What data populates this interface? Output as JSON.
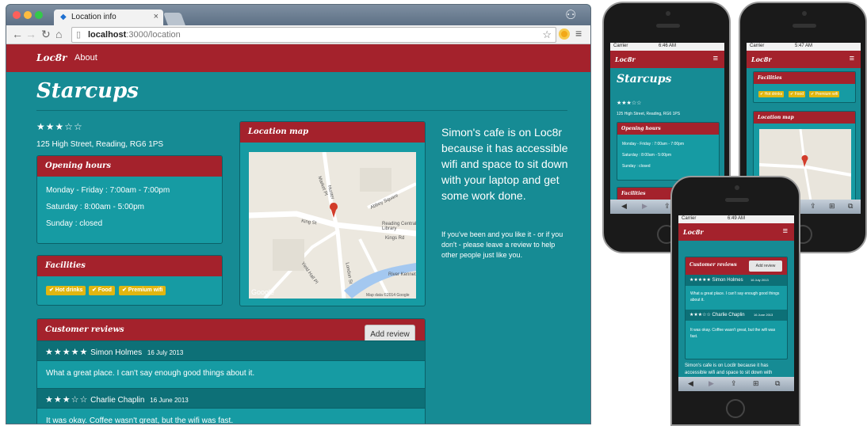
{
  "browser": {
    "tab_title": "Location info",
    "url_host": "localhost",
    "url_rest": ":3000/location"
  },
  "site": {
    "brand": "Loc8r",
    "nav_about": "About",
    "title": "Starcups",
    "rating_stars": "★★★☆☆",
    "address": "125 High Street, Reading, RG6 1PS",
    "hours_title": "Opening hours",
    "hours": [
      "Monday - Friday : 7:00am - 7:00pm",
      "Saturday : 8:00am - 5:00pm",
      "Sunday : closed"
    ],
    "facilities_title": "Facilities",
    "facilities": [
      "✔ Hot drinks",
      "✔ Food",
      "✔ Premium wifi"
    ],
    "map_title": "Location map",
    "map_labels": [
      "Abbey Square",
      "Reading Central Library",
      "King St",
      "Kings Rd",
      "River Kennet",
      "Market Pl",
      "Yield Hall Pl",
      "London St",
      "Map data ©2014 Google",
      "Google",
      "Hunter"
    ],
    "reviews_title": "Customer reviews",
    "add_review": "Add review",
    "reviews": [
      {
        "stars": "★★★★★",
        "author": "Simon Holmes",
        "date": "16 July 2013",
        "text": "What a great place. I can't say enough good things about it."
      },
      {
        "stars": "★★★☆☆",
        "author": "Charlie Chaplin",
        "date": "16 June 2013",
        "text": "It was okay. Coffee wasn't great, but the wifi was fast."
      }
    ],
    "blurb": "Simon's cafe is on Loc8r because it has accessible wifi and space to sit down with your laptop and get some work done.",
    "blurb_small": "If you've been and you like it - or if you don't - please leave a review to help other people just like you."
  },
  "phones": {
    "carrier": "Carrier",
    "times": [
      "6:46 AM",
      "5:47 AM",
      "6:49 AM"
    ],
    "phone1": {
      "address": "125 High Street, Reading, RG6 1PS",
      "hours": [
        "Monday - Friday : 7:00am - 7:00pm",
        "Saturday : 8:00am - 5:00pm",
        "Sunday : closed"
      ]
    },
    "phone2": {
      "facilities": [
        "✔ Hot drinks",
        "✔ Food",
        "✔ Premium wifi"
      ]
    },
    "phone3": {
      "review1_head": "★★★★★ Simon Holmes",
      "review1_date": "16 July 2013",
      "review1_text": "What a great place. I can't say enough good things about it.",
      "review2_head": "★★★☆☆ Charlie Chaplin",
      "review2_date": "16 June 2013",
      "review2_text": "It was okay. Coffee wasn't great, but the wifi was fast.",
      "blurb": "Simon's cafe is on Loc8r because it has accessible wifi and space to sit down with"
    }
  },
  "colors": {
    "brand_red": "#a4222c",
    "teal": "#168b94",
    "badge_yellow": "#e0b610"
  }
}
